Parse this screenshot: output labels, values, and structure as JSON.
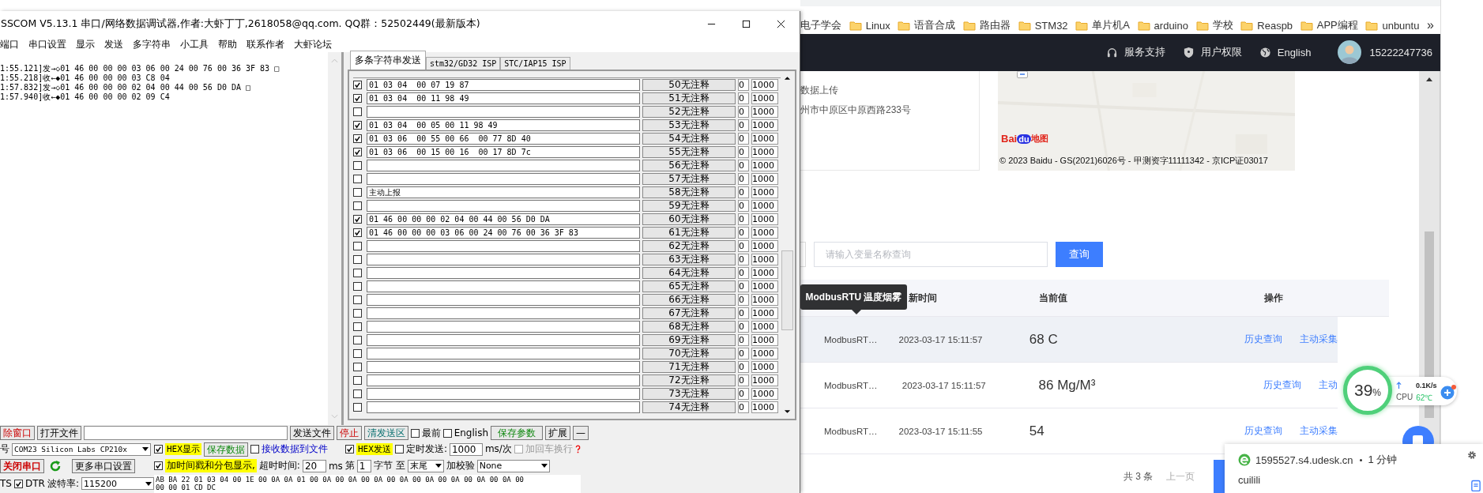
{
  "sscom": {
    "title": "SSCOM V5.13.1 串口/网络数据调试器,作者:大虾丁丁,2618058@qq.com. QQ群：52502449(最新版本)",
    "menu": [
      "端口",
      "串口设置",
      "显示",
      "发送",
      "多字符串",
      "小工具",
      "帮助",
      "联系作者",
      "大虾论坛"
    ],
    "log": [
      "1:55.121]发→◇01 46 00 00 00 03 06 00 24 00 76 00 36 3F 83 □",
      "1:55.218]收←◆01 46 00 00 00 03 C8 04",
      "1:57.832]发→◇01 46 00 00 00 02 04 00 44 00 56 D0 DA □",
      "1:57.940]收←◆01 46 00 00 00 02 09 C4"
    ],
    "tabs": [
      {
        "label": "多条字符串发送",
        "selected": true
      },
      {
        "label": "stm32/GD32 ISP",
        "selected": false
      },
      {
        "label": "STC/IAP15 ISP",
        "selected": false
      }
    ],
    "rows": [
      {
        "checked": true,
        "text": "01 03 04  00 07 19 87",
        "comment": "50无注释",
        "order": "0",
        "delay": "1000"
      },
      {
        "checked": true,
        "text": "01 03 04  00 11 98 49",
        "comment": "51无注释",
        "order": "0",
        "delay": "1000"
      },
      {
        "checked": false,
        "comment": "52无注释",
        "order": "0",
        "delay": "1000"
      },
      {
        "checked": true,
        "text": "01 03 04  00 05 00 11 98 49",
        "comment": "53无注释",
        "order": "0",
        "delay": "1000"
      },
      {
        "checked": true,
        "text": "01 03 06  00 55 00 66  00 77 8D 40",
        "comment": "54无注释",
        "order": "0",
        "delay": "1000"
      },
      {
        "checked": true,
        "text": "01 03 06  00 15 00 16  00 17 8D 7c",
        "comment": "55无注释",
        "order": "0",
        "delay": "1000"
      },
      {
        "checked": false,
        "comment": "56无注释",
        "order": "0",
        "delay": "1000"
      },
      {
        "checked": false,
        "comment": "57无注释",
        "order": "0",
        "delay": "1000"
      },
      {
        "checked": false,
        "text": "主动上报",
        "comment": "58无注释",
        "order": "0",
        "delay": "1000"
      },
      {
        "checked": false,
        "comment": "59无注释",
        "order": "0",
        "delay": "1000"
      },
      {
        "checked": true,
        "text": "01 46 00 00 00 02 04 00 44 00 56 D0 DA",
        "comment": "60无注释",
        "order": "0",
        "delay": "1000"
      },
      {
        "checked": true,
        "text": "01 46 00 00 00 03 06 00 24 00 76 00 36 3F 83",
        "comment": "61无注释",
        "order": "0",
        "delay": "1000"
      },
      {
        "checked": false,
        "comment": "62无注释",
        "order": "0",
        "delay": "1000"
      },
      {
        "checked": false,
        "comment": "63无注释",
        "order": "0",
        "delay": "1000"
      },
      {
        "checked": false,
        "comment": "64无注释",
        "order": "0",
        "delay": "1000"
      },
      {
        "checked": false,
        "comment": "65无注释",
        "order": "0",
        "delay": "1000"
      },
      {
        "checked": false,
        "comment": "66无注释",
        "order": "0",
        "delay": "1000"
      },
      {
        "checked": false,
        "comment": "67无注释",
        "order": "0",
        "delay": "1000"
      },
      {
        "checked": false,
        "comment": "68无注释",
        "order": "0",
        "delay": "1000"
      },
      {
        "checked": false,
        "comment": "69无注释",
        "order": "0",
        "delay": "1000"
      },
      {
        "checked": false,
        "comment": "70无注释",
        "order": "0",
        "delay": "1000"
      },
      {
        "checked": false,
        "comment": "71无注释",
        "order": "0",
        "delay": "1000"
      },
      {
        "checked": false,
        "comment": "72无注释",
        "order": "0",
        "delay": "1000"
      },
      {
        "checked": false,
        "comment": "73无注释",
        "order": "0",
        "delay": "1000"
      },
      {
        "checked": false,
        "comment": "74无注释",
        "order": "0",
        "delay": "1000"
      }
    ],
    "toolbar": {
      "clear_window": "除窗口",
      "open_file": "打开文件",
      "send_file": "发送文件",
      "stop": "停止",
      "clear_send": "清发送区",
      "topmost": {
        "label": "最前",
        "checked": false
      },
      "english": {
        "label": "English",
        "checked": false
      },
      "save_params": "保存参数",
      "expand": "扩展",
      "collapse": "—"
    },
    "port": {
      "label": "号",
      "value": "COM23 Silicon Labs CP210x",
      "close": "关闭串口",
      "more": "更多串口设置",
      "rts_label": "TS",
      "dtr": {
        "label": "DTR",
        "checked": true
      },
      "baud_label": "波特率:",
      "baud": "115200"
    },
    "receive_opts": {
      "hex_display": {
        "label": "HEX显示",
        "checked": true
      },
      "save_data": "保存数据",
      "to_file": {
        "label": "接收数据到文件",
        "checked": false
      },
      "timestamp": {
        "label": "加时间戳和分包显示,",
        "checked": true
      },
      "timeout_label": "超时时间:",
      "timeout": "20",
      "ms": "ms",
      "from_label": "第",
      "from": "1",
      "to_label": "字节 至",
      "to": "末尾",
      "checksum_label": "加校验",
      "checksum": "None"
    },
    "send_opts": {
      "hex_send": {
        "label": "HEX发送",
        "checked": true
      },
      "timed": {
        "label": "定时发送:",
        "checked": false
      },
      "interval": "1000",
      "unit": "ms/次",
      "crlf": {
        "label": "加回车换行",
        "checked": false,
        "disabled": true
      }
    },
    "send_text": [
      "AB BA 22 01 03 04 00 1E 00 0A 0A 01 00 0A 00 0A 00 0A 00 0A 00 0A 00 0A 00 0A 00 0A 00",
      "00 00 01 CD DC"
    ]
  },
  "browser": {
    "bookmarks": [
      {
        "label": "电子学会",
        "folder": false
      },
      {
        "label": "Linux",
        "folder": true
      },
      {
        "label": "语音合成",
        "folder": true
      },
      {
        "label": "路由器",
        "folder": true
      },
      {
        "label": "STM32",
        "folder": true
      },
      {
        "label": "单片机A",
        "folder": true
      },
      {
        "label": "arduino",
        "folder": true
      },
      {
        "label": "学校",
        "folder": true
      },
      {
        "label": "Reaspb",
        "folder": true
      },
      {
        "label": "APP编程",
        "folder": true
      },
      {
        "label": "unbuntu",
        "folder": true
      }
    ],
    "bookmarks_more": "»",
    "nav": {
      "support": "服务支持",
      "permissions": "用户权限",
      "language": "English",
      "phone": "15222247736"
    },
    "device_card": [
      "数据上传",
      "州市中原区中原西路233号"
    ],
    "map": {
      "logo": [
        "Bai",
        "du",
        "地图"
      ],
      "copyright": "© 2023 Baidu - GS(2021)6026号 - 甲测资字11111342 - 京ICP证03017"
    },
    "search": {
      "placeholder": "请输入变量名称查询",
      "button": "查询"
    },
    "table": {
      "columns": [
        "新时间",
        "当前值",
        "操作"
      ],
      "rows": [
        {
          "name": "ModbusRT…",
          "time": "2023-03-17 15:11:57",
          "value": "68 C",
          "actions": [
            "历史查询",
            "主动采集"
          ],
          "hovered": true
        },
        {
          "name": "ModbusRT…",
          "time": "2023-03-17 15:11:57",
          "value": "86 Mg/M³",
          "actions": [
            "历史查询",
            "主动"
          ],
          "hovered": false
        },
        {
          "name": "ModbusRT…",
          "time": "2023-03-17 15:11:55",
          "value": "54",
          "actions": [
            "历史查询",
            "主动采集"
          ],
          "hovered": false
        }
      ]
    },
    "tooltip": "ModbusRTU 温度烟雾",
    "pagination": {
      "total": "共 3 条",
      "prev": "上一页"
    }
  },
  "monitor": {
    "percent": "39",
    "unit": "%",
    "upload": "0.1K/s",
    "cpu_label": "CPU",
    "cpu_temp": "62℃"
  },
  "notification": {
    "site": "1595527.s4.udesk.cn",
    "time": "1 分钟",
    "sender": "cuilili"
  }
}
